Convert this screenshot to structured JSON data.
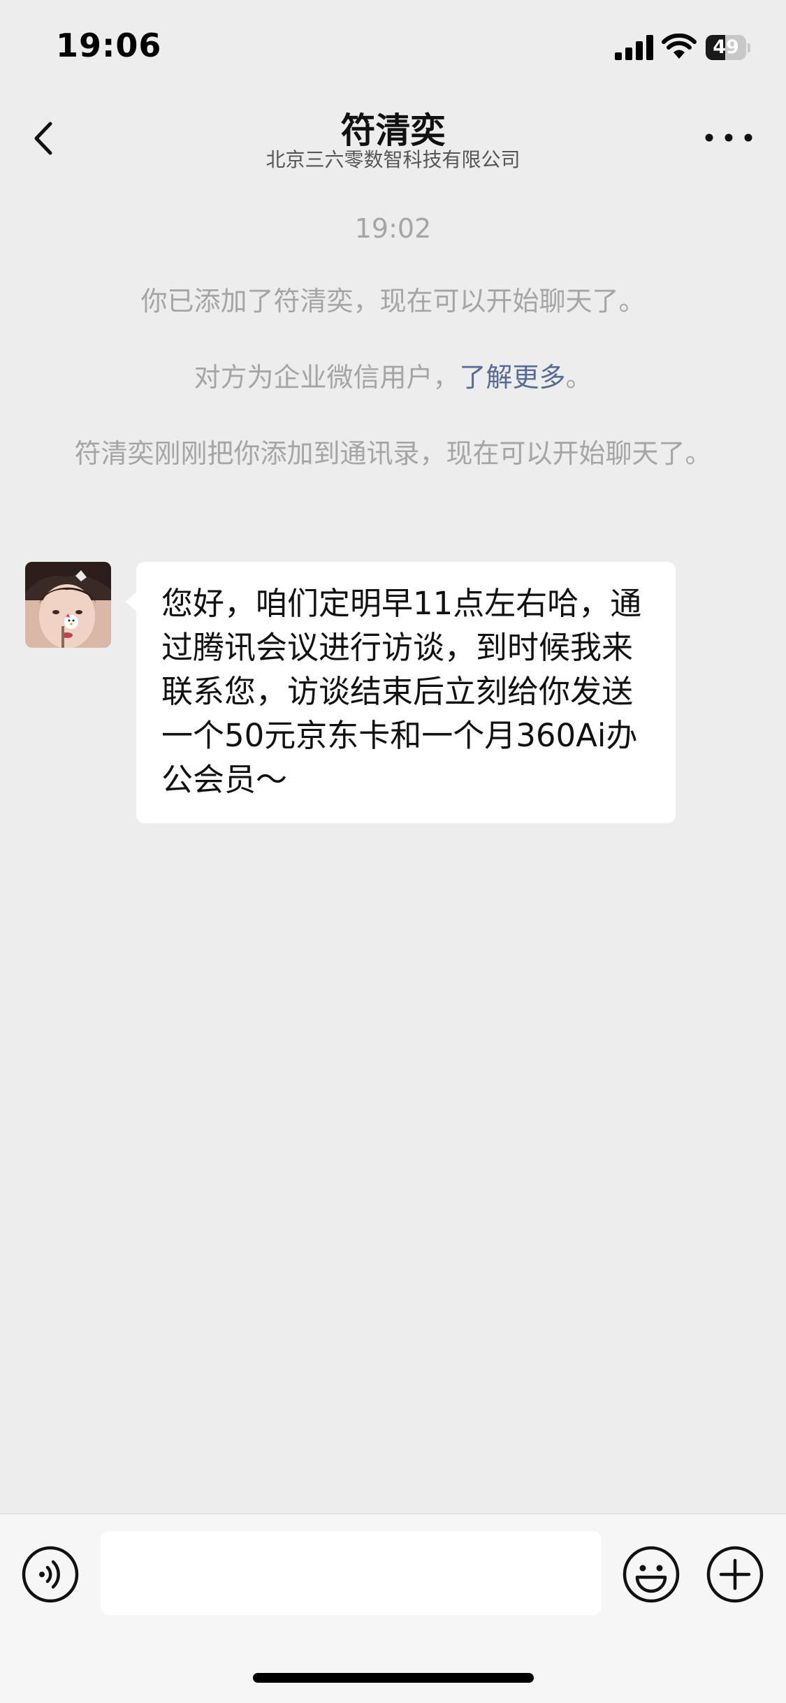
{
  "status_bar": {
    "time": "19:06",
    "battery_level": "49",
    "battery_fraction": 0.49,
    "icons": [
      "signal-icon",
      "wifi-icon",
      "battery-icon"
    ]
  },
  "nav": {
    "back_icon": "chevron-left-icon",
    "title": "符清奕",
    "subtitle": "北京三六零数智科技有限公司",
    "more_icon": "ellipsis-icon"
  },
  "system": {
    "time": "19:02",
    "added_msg": "你已添加了符清奕，现在可以开始聊天了。",
    "enterprise_prefix": "对方为企业微信用户，",
    "enterprise_link": "了解更多",
    "enterprise_suffix": "。",
    "contact_msg": "符清奕刚刚把你添加到通讯录，现在可以开始聊天了。"
  },
  "messages": [
    {
      "sender": "符清奕",
      "avatar_icon": "avatar-photo",
      "text": "您好，咱们定明早11点左右哈，通过腾讯会议进行访谈，到时候我来联系您，访谈结束后立刻给你发送一个50元京东卡和一个月360Ai办公会员～"
    }
  ],
  "input_bar": {
    "voice_icon": "voice-icon",
    "input_value": "",
    "emoji_icon": "emoji-icon",
    "plus_icon": "plus-circle-icon"
  },
  "colors": {
    "background": "#ededed",
    "bubble": "#ffffff",
    "system_text": "#a5a5a5",
    "link": "#576b95",
    "input_bar": "#f6f6f6"
  }
}
